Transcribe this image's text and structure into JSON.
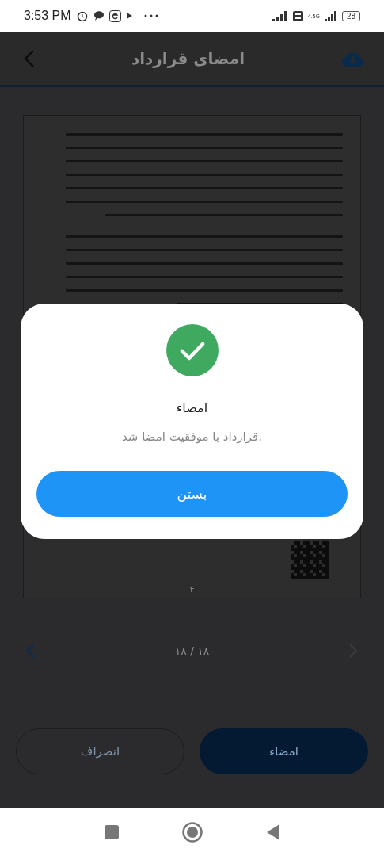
{
  "status_bar": {
    "time": "3:53 PM",
    "network": "4.5G",
    "battery": "28"
  },
  "header": {
    "title": "امضای قرارداد"
  },
  "document": {
    "page_number": "۴"
  },
  "pager": {
    "text": "۱۸ / ۱۸",
    "prev_disabled": false,
    "next_disabled": true
  },
  "actions": [
    {
      "label": "امضاء",
      "kind": "primary"
    },
    {
      "label": "انصراف",
      "kind": "outline"
    }
  ],
  "dialog": {
    "title": "امضاء",
    "message": "قرارداد با موفقیت امضا شد.",
    "button": "بستن"
  }
}
